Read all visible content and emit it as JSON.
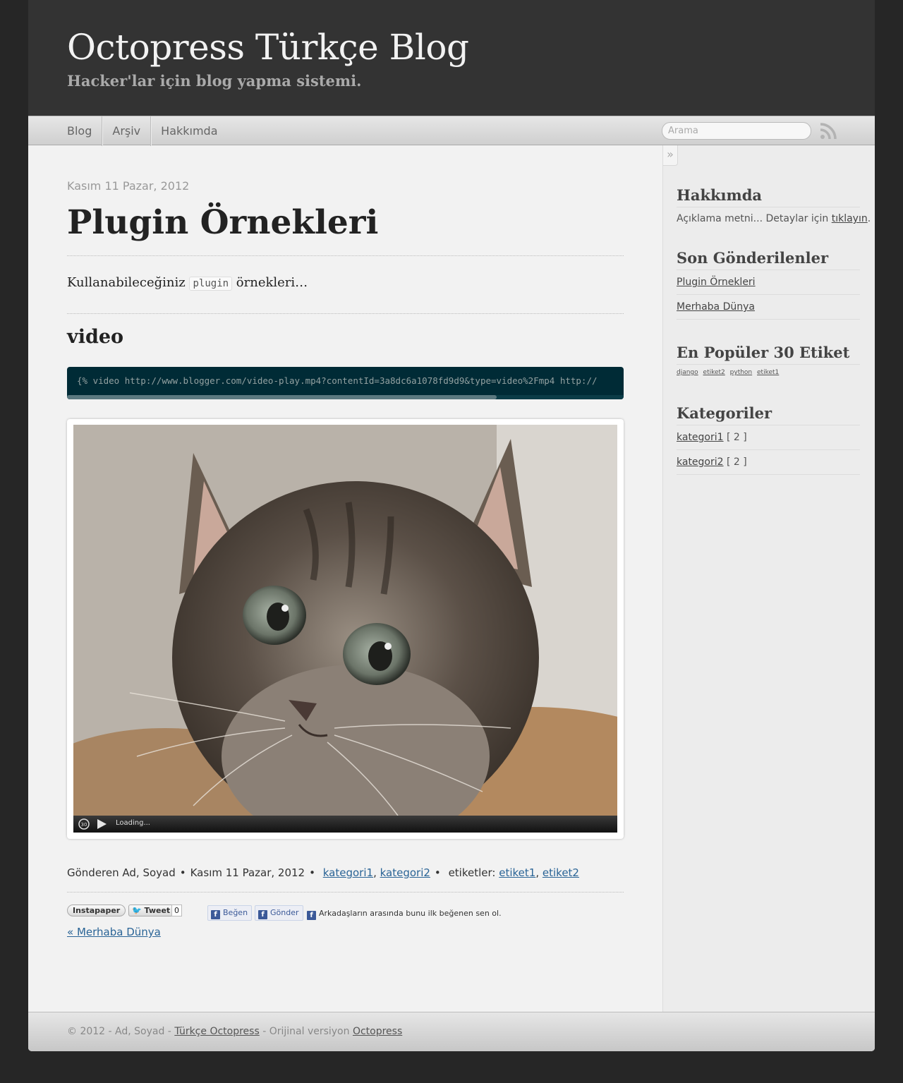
{
  "header": {
    "title": "Octopress Türkçe Blog",
    "subtitle": "Hacker'lar için blog yapma sistemi."
  },
  "nav": {
    "items": [
      {
        "label": "Blog"
      },
      {
        "label": "Arşiv"
      },
      {
        "label": "Hakkımda"
      }
    ],
    "search_placeholder": "Arama",
    "rss_icon": "rss-icon"
  },
  "post": {
    "date": "Kasım 11 Pazar, 2012",
    "title": "Plugin Örnekleri",
    "intro_before": "Kullanabileceğiniz",
    "intro_code": "plugin",
    "intro_after": "örnekleri…",
    "section_heading": "video",
    "code_line": "{% video http://www.blogger.com/video-play.mp4?contentId=3a8dc6a1078fd9d9&type=video%2Fmp4 http://",
    "video": {
      "loading_text": "Loading...",
      "poster_description": "kitten"
    },
    "meta": {
      "author": "Gönderen Ad, Soyad",
      "date": "Kasım 11 Pazar, 2012",
      "categories": [
        "kategori1",
        "kategori2"
      ],
      "tags_label": "etiketler:",
      "tags": [
        "etiket1",
        "etiket2"
      ]
    },
    "sharing": {
      "instapaper": "Instapaper",
      "tweet": "Tweet",
      "tweet_count": "0",
      "like": "Beğen",
      "send": "Gönder",
      "fb_note": "Arkadaşların arasında bunu ilk beğenen sen ol."
    },
    "prev_link": "« Merhaba Dünya"
  },
  "sidebar": {
    "about": {
      "title": "Hakkımda",
      "text": "Açıklama metni... Detaylar için",
      "link": "tıklayın",
      "after": "."
    },
    "recent": {
      "title": "Son Gönderilenler",
      "items": [
        "Plugin Örnekleri",
        "Merhaba Dünya"
      ]
    },
    "tags": {
      "title": "En Popüler 30 Etiket",
      "items": [
        "django",
        "etiket2",
        "python",
        "etiket1"
      ]
    },
    "categories": {
      "title": "Kategoriler",
      "items": [
        {
          "name": "kategori1",
          "count": "[ 2 ]"
        },
        {
          "name": "kategori2",
          "count": "[ 2 ]"
        }
      ]
    },
    "collapse_glyph": "»"
  },
  "footer": {
    "prefix": "© 2012 - Ad, Soyad - ",
    "link1": "Türkçe Octopress",
    "middle": " - Orijinal versiyon ",
    "link2": "Octopress"
  },
  "colors": {
    "background": "#262626",
    "header": "#333333",
    "page": "#f2f2f2",
    "link": "#2a6496",
    "code_bg": "#002b36"
  }
}
